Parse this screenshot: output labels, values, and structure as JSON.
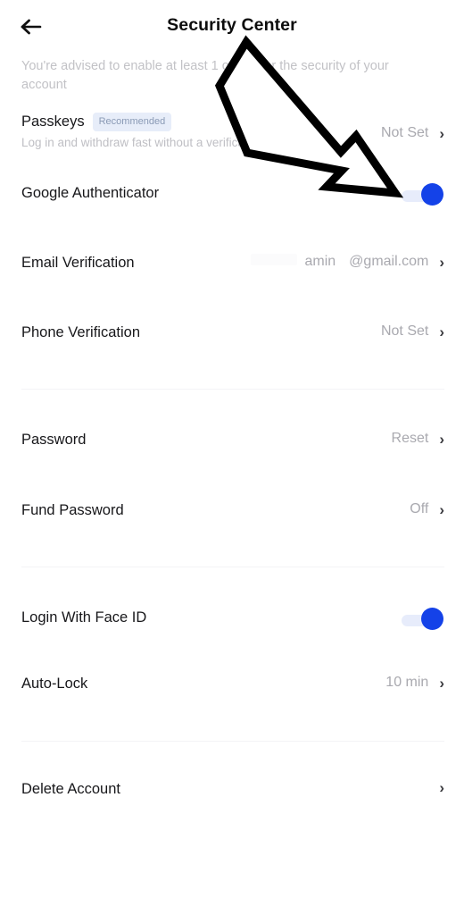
{
  "header": {
    "back_icon": "arrow-left-icon",
    "title": "Security Center"
  },
  "intro": {
    "text": "You're advised to enable at least 1 option for the security of your account"
  },
  "colors": {
    "accent_blue": "#1442e8",
    "toggle_track": "#e7ecfb",
    "badge_bg": "#e7edf9",
    "badge_text": "#8a9ab5",
    "muted_text": "#a9a9af",
    "title_text": "#17171a",
    "divider": "#f4f4f6"
  },
  "sections": [
    {
      "name": "verification",
      "rows": [
        {
          "name": "passkeys",
          "title": "Passkeys",
          "badge": "Recommended",
          "subtitle": "Log in and withdraw fast without a verification code",
          "value": "Not Set",
          "control": "chevron",
          "chevron": "›"
        },
        {
          "name": "google-authenticator",
          "title": "Google Authenticator",
          "badge": "",
          "subtitle": "",
          "value": "",
          "control": "toggle",
          "toggle_on": true
        },
        {
          "name": "email-verification",
          "title": "Email Verification",
          "badge": "",
          "subtitle": "",
          "value": "amin @gmail.com",
          "email_masked_prefix": "",
          "email_visible_user": "amin",
          "email_domain": "@gmail.com",
          "control": "chevron-email",
          "chevron": "›"
        },
        {
          "name": "phone-verification",
          "title": "Phone Verification",
          "badge": "",
          "subtitle": "",
          "value": "Not Set",
          "control": "chevron",
          "chevron": "›"
        }
      ]
    },
    {
      "name": "passwords",
      "rows": [
        {
          "name": "password",
          "title": "Password",
          "badge": "",
          "subtitle": "",
          "value": "Reset",
          "control": "chevron",
          "chevron": "›"
        },
        {
          "name": "fund-password",
          "title": "Fund Password",
          "badge": "",
          "subtitle": "",
          "value": "Off",
          "control": "chevron",
          "chevron": "›"
        }
      ]
    },
    {
      "name": "device",
      "rows": [
        {
          "name": "login-with-face-id",
          "title": "Login With Face ID",
          "badge": "",
          "subtitle": "",
          "value": "",
          "control": "toggle",
          "toggle_on": true
        },
        {
          "name": "auto-lock",
          "title": "Auto-Lock",
          "badge": "",
          "subtitle": "",
          "value": "10 min",
          "control": "chevron",
          "chevron": "›"
        }
      ]
    },
    {
      "name": "account",
      "rows": [
        {
          "name": "delete-account",
          "title": "Delete Account",
          "badge": "",
          "subtitle": "",
          "value": "",
          "control": "chevron",
          "chevron": "›"
        }
      ]
    }
  ],
  "annotation": {
    "name": "pointer-arrow-overlay",
    "points_at": "google-authenticator-toggle"
  }
}
